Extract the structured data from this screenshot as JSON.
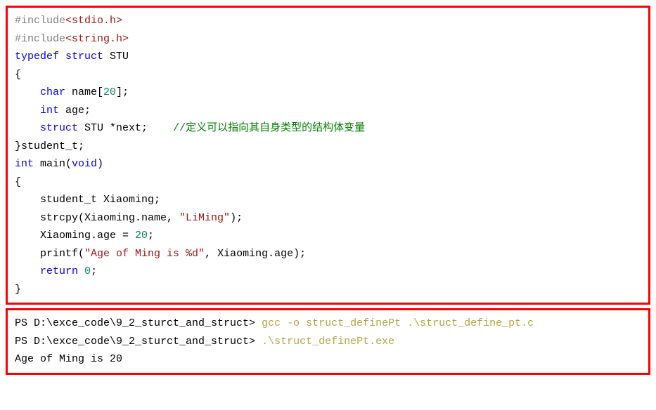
{
  "code": {
    "l1_pre": "#include",
    "l1_file": "<stdio.h>",
    "l2_pre": "#include",
    "l2_file": "<string.h>",
    "l3_typedef": "typedef",
    "l3_struct": "struct",
    "l3_name": " STU",
    "l4": "{",
    "l5_pad": "    ",
    "l5_kw": "char",
    "l5_rest": " name[",
    "l5_num": "20",
    "l5_end": "];",
    "l6_pad": "    ",
    "l6_kw": "int",
    "l6_rest": " age;",
    "l7_pad": "    ",
    "l7_kw": "struct",
    "l7_mid": " STU *next;    ",
    "l7_comment": "//定义可以指向其自身类型的结构体变量",
    "l8": "}student_t;",
    "l9": "",
    "l10_kw1": "int",
    "l10_mid": " main(",
    "l10_kw2": "void",
    "l10_end": ")",
    "l11": "{",
    "l12": "    student_t Xiaoming;",
    "l13_pad": "    strcpy(Xiaoming.name, ",
    "l13_str": "\"LiMing\"",
    "l13_end": ");",
    "l14_pad": "    Xiaoming.age = ",
    "l14_num": "20",
    "l14_end": ";",
    "l15_pad": "    printf(",
    "l15_str": "\"Age of Ming is %d\"",
    "l15_end": ", Xiaoming.age);",
    "l16_pad": "    ",
    "l16_kw": "return",
    "l16_sp": " ",
    "l16_num": "0",
    "l16_end": ";",
    "l17": "}"
  },
  "terminal": {
    "l1_prompt": "PS D:\\exce_code\\9_2_sturct_and_struct> ",
    "l1_cmd": "gcc -o struct_definePt .\\struct_define_pt.c",
    "l2_prompt": "PS D:\\exce_code\\9_2_sturct_and_struct> ",
    "l2_cmd": ".\\struct_definePt.exe",
    "l3": "Age of Ming is 20"
  }
}
